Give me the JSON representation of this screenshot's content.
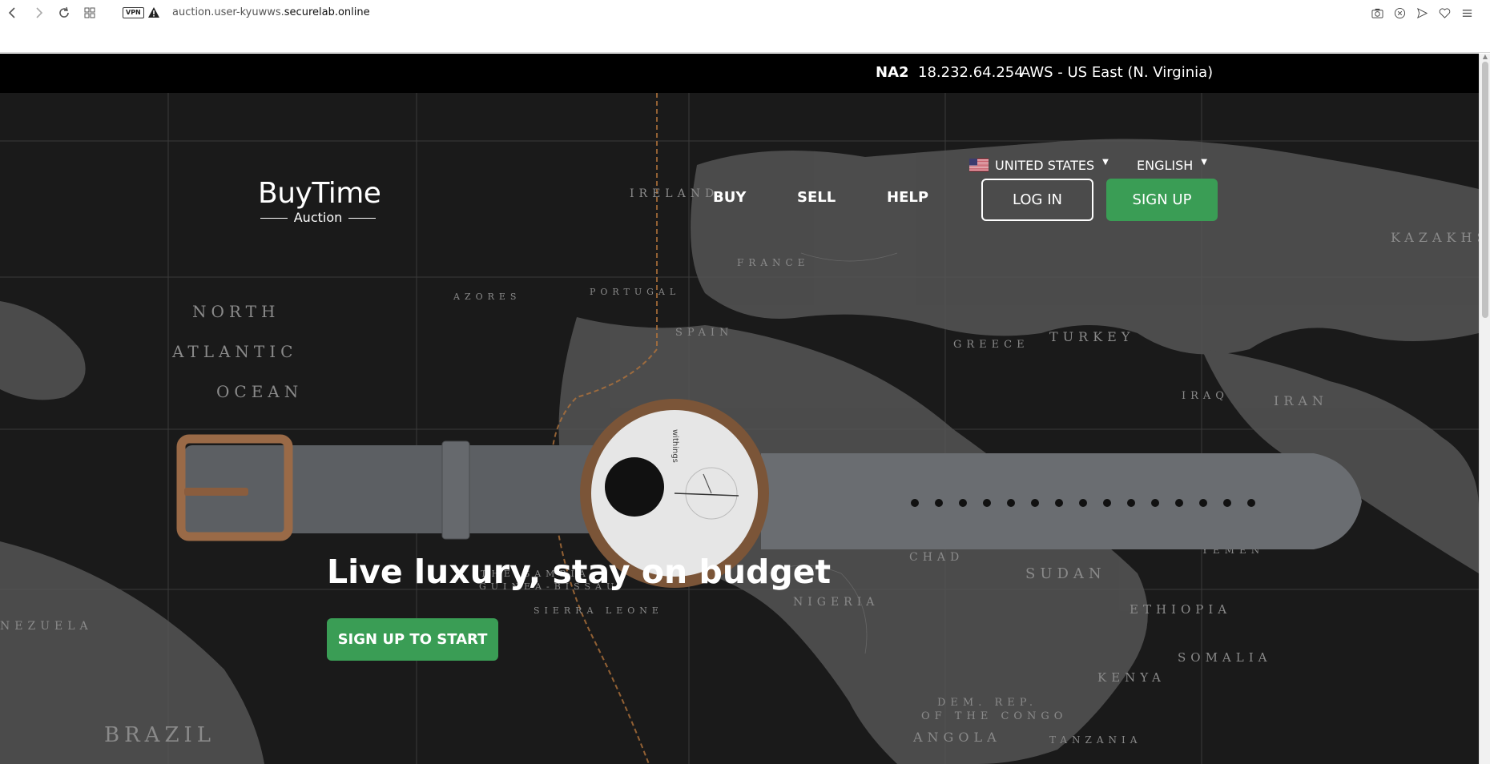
{
  "browser": {
    "vpn_label": "VPN",
    "url_prefix": "auction.user-kyuwws.",
    "url_host": "securelab.online"
  },
  "server_bar": {
    "code": "NA2",
    "ip": "18.232.64.254",
    "region": "AWS - US East (N. Virginia)"
  },
  "locale": {
    "country": "UNITED STATES",
    "language": "ENGLISH"
  },
  "logo": {
    "brand": "BuyTime",
    "sub": "Auction"
  },
  "nav": {
    "buy": "BUY",
    "sell": "SELL",
    "help": "HELP",
    "login": "LOG IN",
    "signup": "SIGN UP"
  },
  "hero": {
    "headline": "Live luxury, stay on budget",
    "cta": "SIGN UP TO START",
    "watch_brand": "withings"
  },
  "map_labels": [
    "NORTH",
    "ATLANTIC",
    "OCEAN",
    "BRAZIL",
    "SUDAN",
    "ETHIOPIA",
    "KENYA",
    "SOMALIA",
    "IRAN",
    "TURKEY",
    "SPAIN",
    "KAZAKHS",
    "ANGOLA",
    "TANZANIA",
    "NIGERIA",
    "CHAD",
    "DEM. REP.",
    "OF THE CONGO",
    "IRAQ",
    "YEMEN",
    "GREECE",
    "FRANCE",
    "IRELAND",
    "PORTUGAL",
    "THE GAMBIA",
    "GUINEA-BISSAU",
    "SIERRA LEONE",
    "NEZUELA",
    "AZORES"
  ],
  "colors": {
    "accent_green": "#3a9d55",
    "server_bar_bg": "#000000",
    "hero_bg": "#1c1c1c"
  }
}
